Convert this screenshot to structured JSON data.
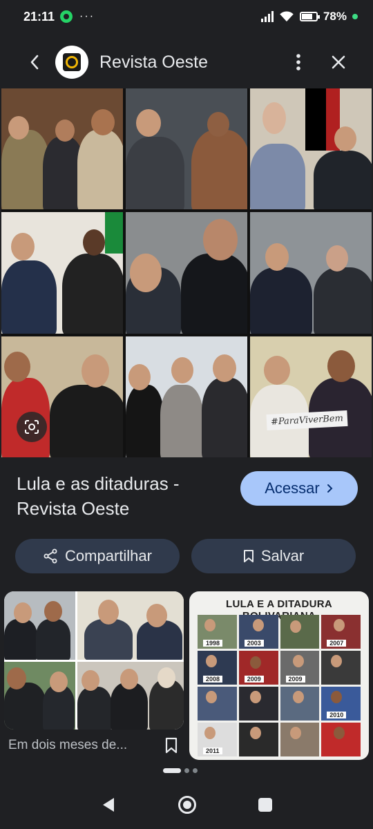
{
  "status_bar": {
    "time": "21:11",
    "dots": "···",
    "battery_percent": "78%",
    "battery_level": 0.78
  },
  "header": {
    "site_name": "Revista Oeste"
  },
  "result": {
    "title_line1": "Lula e as ditaduras -",
    "title_line2": "Revista Oeste",
    "visit_label": "Acessar",
    "share_label": "Compartilhar",
    "save_label": "Salvar"
  },
  "main_image_sign_text": "#ParaViverBem",
  "related": {
    "card1_caption": "Em dois meses de...",
    "card2_title": "LULA E A DITADURA BOLIVARIANA",
    "card2_years": [
      "1998",
      "2003",
      "2007",
      "2008",
      "2009",
      "2009",
      "2010",
      "2011"
    ]
  },
  "icons": {
    "back": "arrow-left-icon",
    "more": "more-vert-icon",
    "close": "close-icon",
    "lens": "google-lens-icon",
    "share": "share-icon",
    "bookmark": "bookmark-icon",
    "chevron": "chevron-right-icon"
  },
  "colors": {
    "background": "#1f2023",
    "accent_button": "#a8c7fa",
    "chip_background": "#303a4c"
  }
}
